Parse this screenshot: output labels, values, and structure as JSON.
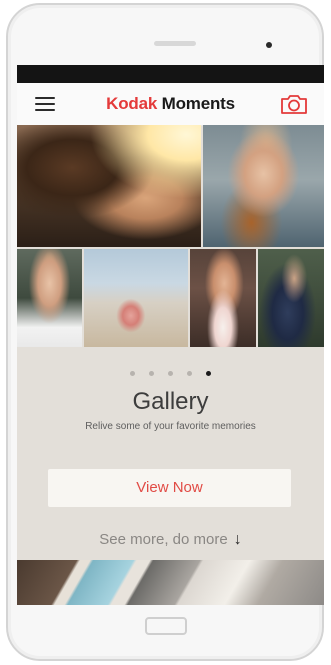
{
  "app": {
    "brand": "Kodak",
    "brand_suffix": " Moments"
  },
  "header": {
    "menu_icon": "hamburger-menu-icon",
    "camera_icon": "camera-icon"
  },
  "carousel": {
    "title": "Gallery",
    "subtitle": "Relive some of your favorite memories",
    "page_count": 5,
    "active_page": 5
  },
  "actions": {
    "view_now": "View Now",
    "see_more": "See more, do more",
    "see_more_arrow": "↓"
  },
  "colors": {
    "brand_red": "#e43a3a",
    "screen_bg": "#e3dfd9",
    "cta_text": "#e14b45"
  }
}
